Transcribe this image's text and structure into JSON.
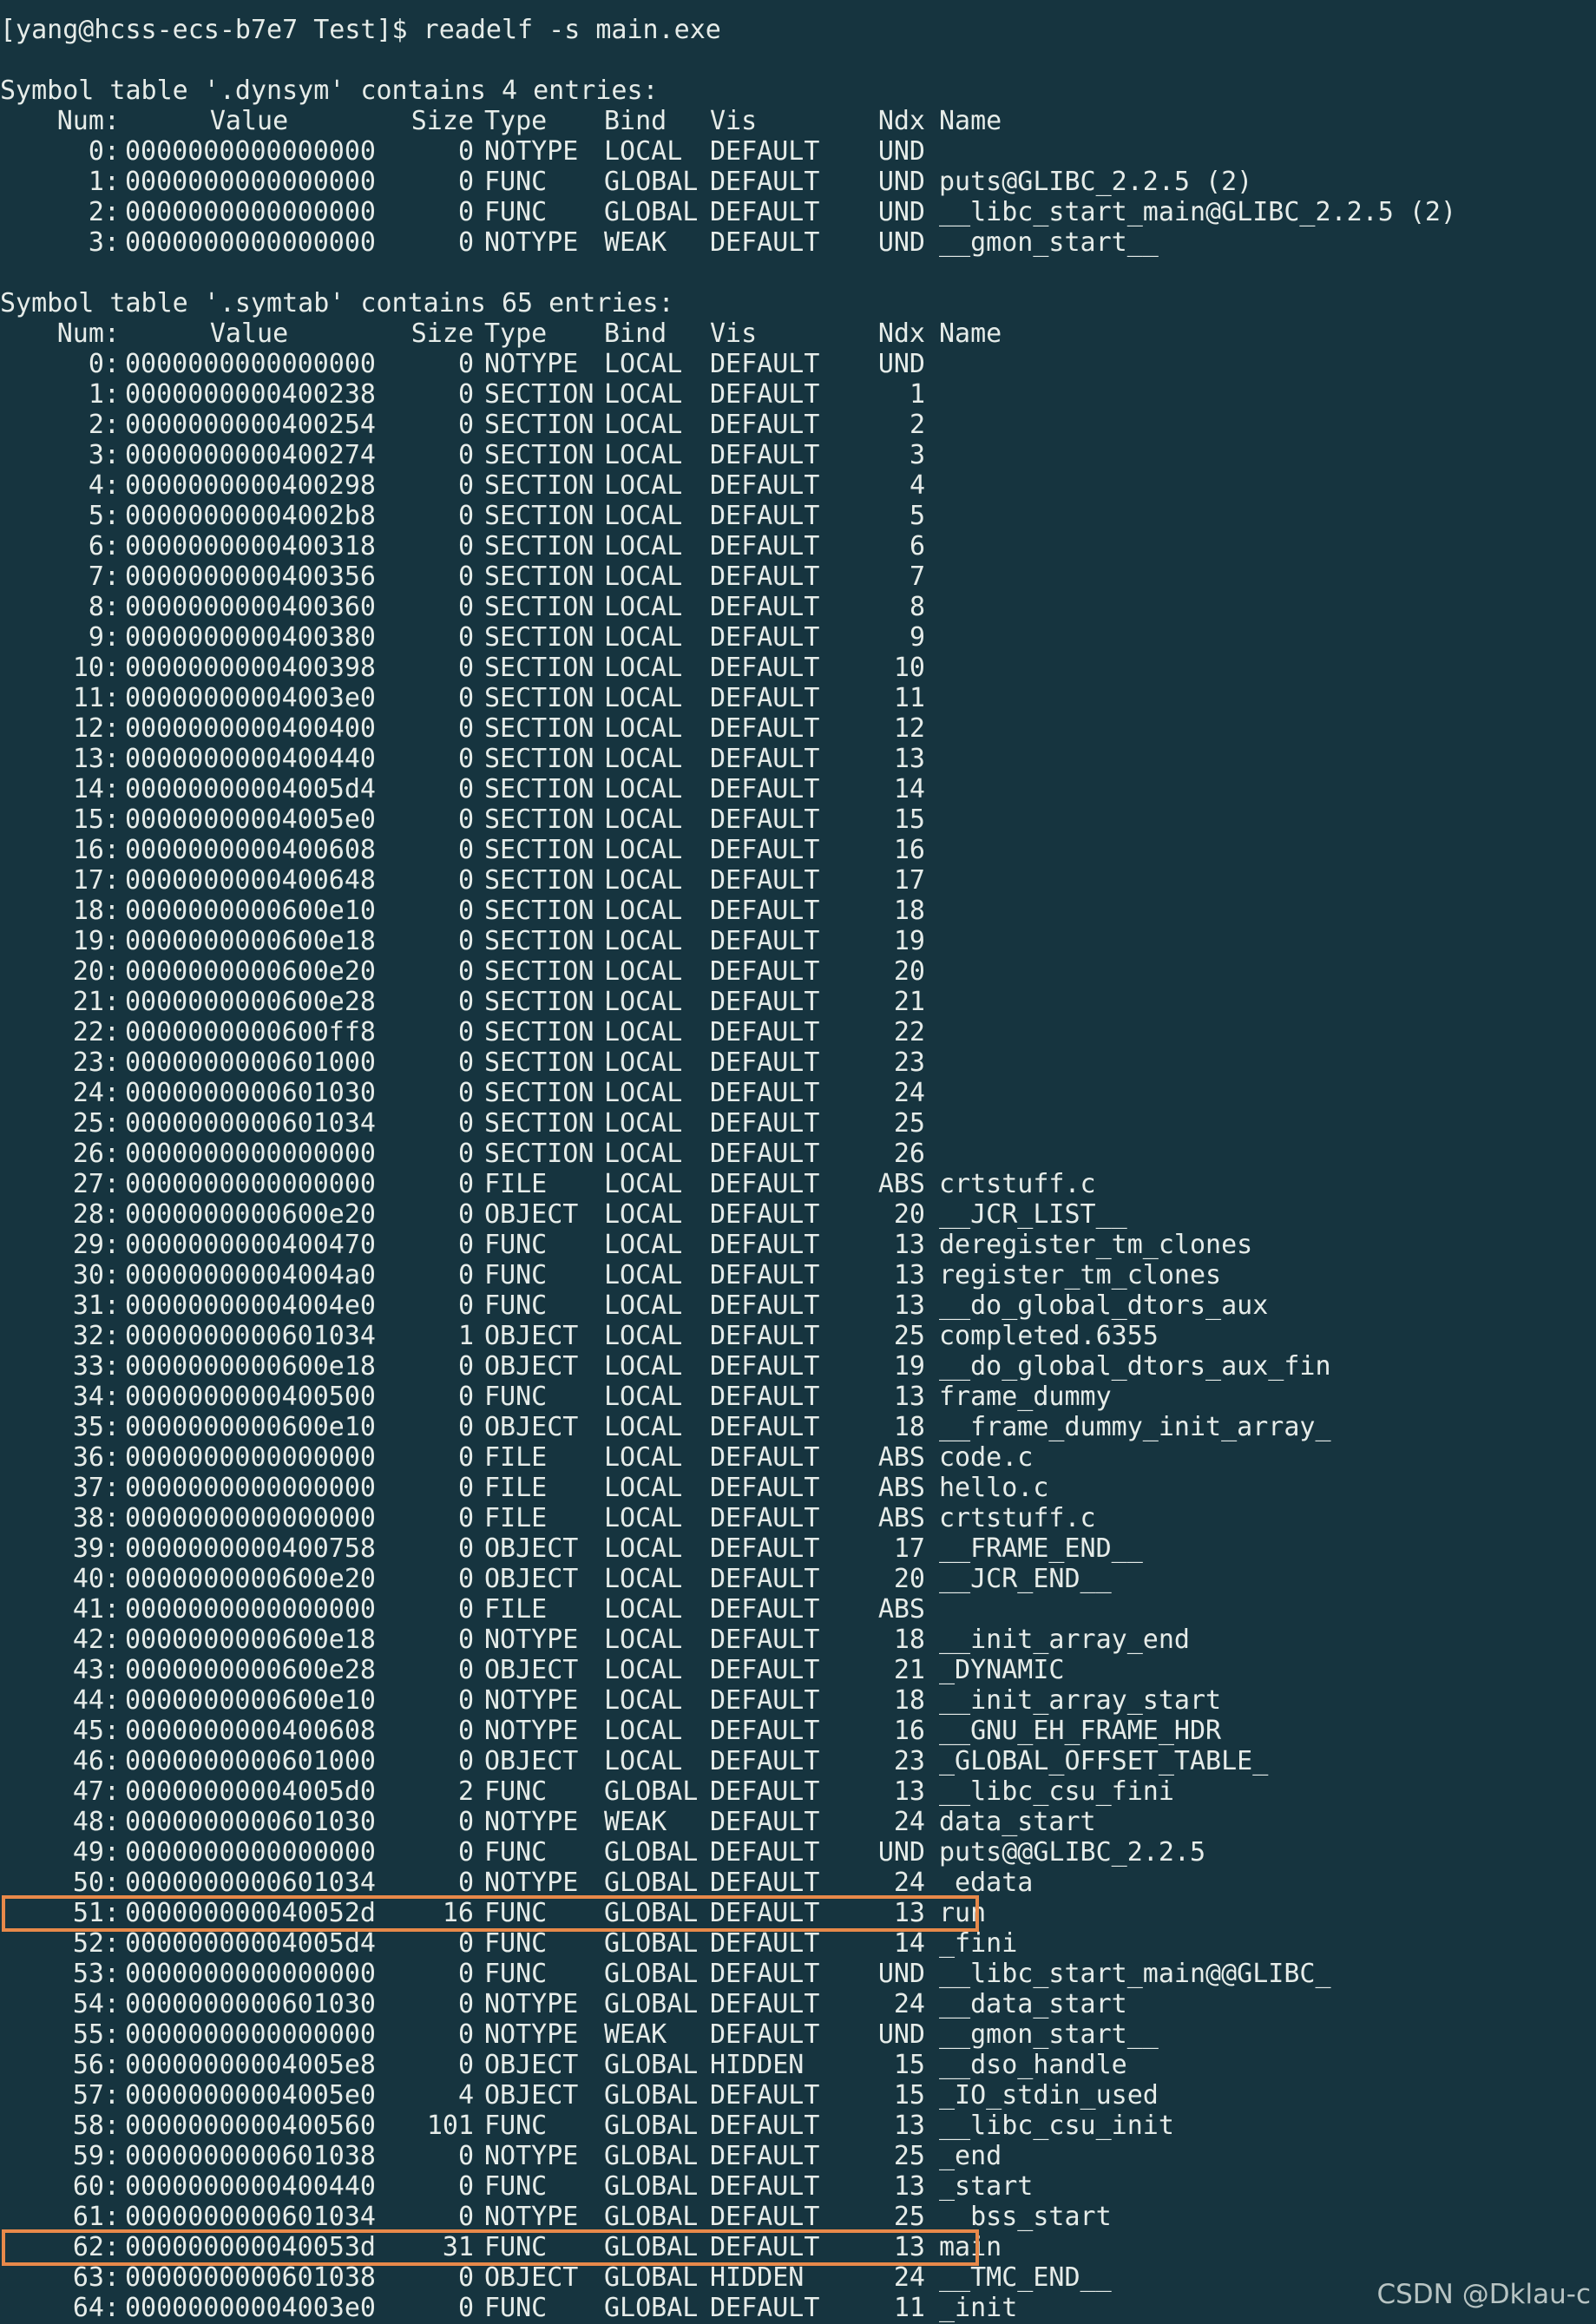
{
  "prompt": "[yang@hcss-ecs-b7e7 Test]$ readelf -s main.exe",
  "headers": {
    "num": "Num:",
    "value": "Value",
    "size": "Size",
    "type": "Type",
    "bind": "Bind",
    "vis": "Vis",
    "ndx": "Ndx",
    "name": "Name"
  },
  "dynsym": {
    "title": "Symbol table '.dynsym' contains 4 entries:",
    "rows": [
      [
        "0:",
        "0000000000000000",
        "0",
        "NOTYPE",
        "LOCAL",
        "DEFAULT",
        "UND",
        ""
      ],
      [
        "1:",
        "0000000000000000",
        "0",
        "FUNC",
        "GLOBAL",
        "DEFAULT",
        "UND",
        "puts@GLIBC_2.2.5 (2)"
      ],
      [
        "2:",
        "0000000000000000",
        "0",
        "FUNC",
        "GLOBAL",
        "DEFAULT",
        "UND",
        "__libc_start_main@GLIBC_2.2.5 (2)"
      ],
      [
        "3:",
        "0000000000000000",
        "0",
        "NOTYPE",
        "WEAK",
        "DEFAULT",
        "UND",
        "__gmon_start__"
      ]
    ]
  },
  "symtab": {
    "title": "Symbol table '.symtab' contains 65 entries:",
    "rows": [
      [
        "0:",
        "0000000000000000",
        "0",
        "NOTYPE",
        "LOCAL",
        "DEFAULT",
        "UND",
        ""
      ],
      [
        "1:",
        "0000000000400238",
        "0",
        "SECTION",
        "LOCAL",
        "DEFAULT",
        "1",
        ""
      ],
      [
        "2:",
        "0000000000400254",
        "0",
        "SECTION",
        "LOCAL",
        "DEFAULT",
        "2",
        ""
      ],
      [
        "3:",
        "0000000000400274",
        "0",
        "SECTION",
        "LOCAL",
        "DEFAULT",
        "3",
        ""
      ],
      [
        "4:",
        "0000000000400298",
        "0",
        "SECTION",
        "LOCAL",
        "DEFAULT",
        "4",
        ""
      ],
      [
        "5:",
        "00000000004002b8",
        "0",
        "SECTION",
        "LOCAL",
        "DEFAULT",
        "5",
        ""
      ],
      [
        "6:",
        "0000000000400318",
        "0",
        "SECTION",
        "LOCAL",
        "DEFAULT",
        "6",
        ""
      ],
      [
        "7:",
        "0000000000400356",
        "0",
        "SECTION",
        "LOCAL",
        "DEFAULT",
        "7",
        ""
      ],
      [
        "8:",
        "0000000000400360",
        "0",
        "SECTION",
        "LOCAL",
        "DEFAULT",
        "8",
        ""
      ],
      [
        "9:",
        "0000000000400380",
        "0",
        "SECTION",
        "LOCAL",
        "DEFAULT",
        "9",
        ""
      ],
      [
        "10:",
        "0000000000400398",
        "0",
        "SECTION",
        "LOCAL",
        "DEFAULT",
        "10",
        ""
      ],
      [
        "11:",
        "00000000004003e0",
        "0",
        "SECTION",
        "LOCAL",
        "DEFAULT",
        "11",
        ""
      ],
      [
        "12:",
        "0000000000400400",
        "0",
        "SECTION",
        "LOCAL",
        "DEFAULT",
        "12",
        ""
      ],
      [
        "13:",
        "0000000000400440",
        "0",
        "SECTION",
        "LOCAL",
        "DEFAULT",
        "13",
        ""
      ],
      [
        "14:",
        "00000000004005d4",
        "0",
        "SECTION",
        "LOCAL",
        "DEFAULT",
        "14",
        ""
      ],
      [
        "15:",
        "00000000004005e0",
        "0",
        "SECTION",
        "LOCAL",
        "DEFAULT",
        "15",
        ""
      ],
      [
        "16:",
        "0000000000400608",
        "0",
        "SECTION",
        "LOCAL",
        "DEFAULT",
        "16",
        ""
      ],
      [
        "17:",
        "0000000000400648",
        "0",
        "SECTION",
        "LOCAL",
        "DEFAULT",
        "17",
        ""
      ],
      [
        "18:",
        "0000000000600e10",
        "0",
        "SECTION",
        "LOCAL",
        "DEFAULT",
        "18",
        ""
      ],
      [
        "19:",
        "0000000000600e18",
        "0",
        "SECTION",
        "LOCAL",
        "DEFAULT",
        "19",
        ""
      ],
      [
        "20:",
        "0000000000600e20",
        "0",
        "SECTION",
        "LOCAL",
        "DEFAULT",
        "20",
        ""
      ],
      [
        "21:",
        "0000000000600e28",
        "0",
        "SECTION",
        "LOCAL",
        "DEFAULT",
        "21",
        ""
      ],
      [
        "22:",
        "0000000000600ff8",
        "0",
        "SECTION",
        "LOCAL",
        "DEFAULT",
        "22",
        ""
      ],
      [
        "23:",
        "0000000000601000",
        "0",
        "SECTION",
        "LOCAL",
        "DEFAULT",
        "23",
        ""
      ],
      [
        "24:",
        "0000000000601030",
        "0",
        "SECTION",
        "LOCAL",
        "DEFAULT",
        "24",
        ""
      ],
      [
        "25:",
        "0000000000601034",
        "0",
        "SECTION",
        "LOCAL",
        "DEFAULT",
        "25",
        ""
      ],
      [
        "26:",
        "0000000000000000",
        "0",
        "SECTION",
        "LOCAL",
        "DEFAULT",
        "26",
        ""
      ],
      [
        "27:",
        "0000000000000000",
        "0",
        "FILE",
        "LOCAL",
        "DEFAULT",
        "ABS",
        "crtstuff.c"
      ],
      [
        "28:",
        "0000000000600e20",
        "0",
        "OBJECT",
        "LOCAL",
        "DEFAULT",
        "20",
        "__JCR_LIST__"
      ],
      [
        "29:",
        "0000000000400470",
        "0",
        "FUNC",
        "LOCAL",
        "DEFAULT",
        "13",
        "deregister_tm_clones"
      ],
      [
        "30:",
        "00000000004004a0",
        "0",
        "FUNC",
        "LOCAL",
        "DEFAULT",
        "13",
        "register_tm_clones"
      ],
      [
        "31:",
        "00000000004004e0",
        "0",
        "FUNC",
        "LOCAL",
        "DEFAULT",
        "13",
        "__do_global_dtors_aux"
      ],
      [
        "32:",
        "0000000000601034",
        "1",
        "OBJECT",
        "LOCAL",
        "DEFAULT",
        "25",
        "completed.6355"
      ],
      [
        "33:",
        "0000000000600e18",
        "0",
        "OBJECT",
        "LOCAL",
        "DEFAULT",
        "19",
        "__do_global_dtors_aux_fin"
      ],
      [
        "34:",
        "0000000000400500",
        "0",
        "FUNC",
        "LOCAL",
        "DEFAULT",
        "13",
        "frame_dummy"
      ],
      [
        "35:",
        "0000000000600e10",
        "0",
        "OBJECT",
        "LOCAL",
        "DEFAULT",
        "18",
        "__frame_dummy_init_array_"
      ],
      [
        "36:",
        "0000000000000000",
        "0",
        "FILE",
        "LOCAL",
        "DEFAULT",
        "ABS",
        "code.c"
      ],
      [
        "37:",
        "0000000000000000",
        "0",
        "FILE",
        "LOCAL",
        "DEFAULT",
        "ABS",
        "hello.c"
      ],
      [
        "38:",
        "0000000000000000",
        "0",
        "FILE",
        "LOCAL",
        "DEFAULT",
        "ABS",
        "crtstuff.c"
      ],
      [
        "39:",
        "0000000000400758",
        "0",
        "OBJECT",
        "LOCAL",
        "DEFAULT",
        "17",
        "__FRAME_END__"
      ],
      [
        "40:",
        "0000000000600e20",
        "0",
        "OBJECT",
        "LOCAL",
        "DEFAULT",
        "20",
        "__JCR_END__"
      ],
      [
        "41:",
        "0000000000000000",
        "0",
        "FILE",
        "LOCAL",
        "DEFAULT",
        "ABS",
        ""
      ],
      [
        "42:",
        "0000000000600e18",
        "0",
        "NOTYPE",
        "LOCAL",
        "DEFAULT",
        "18",
        "__init_array_end"
      ],
      [
        "43:",
        "0000000000600e28",
        "0",
        "OBJECT",
        "LOCAL",
        "DEFAULT",
        "21",
        "_DYNAMIC"
      ],
      [
        "44:",
        "0000000000600e10",
        "0",
        "NOTYPE",
        "LOCAL",
        "DEFAULT",
        "18",
        "__init_array_start"
      ],
      [
        "45:",
        "0000000000400608",
        "0",
        "NOTYPE",
        "LOCAL",
        "DEFAULT",
        "16",
        "__GNU_EH_FRAME_HDR"
      ],
      [
        "46:",
        "0000000000601000",
        "0",
        "OBJECT",
        "LOCAL",
        "DEFAULT",
        "23",
        "_GLOBAL_OFFSET_TABLE_"
      ],
      [
        "47:",
        "00000000004005d0",
        "2",
        "FUNC",
        "GLOBAL",
        "DEFAULT",
        "13",
        "__libc_csu_fini"
      ],
      [
        "48:",
        "0000000000601030",
        "0",
        "NOTYPE",
        "WEAK",
        "DEFAULT",
        "24",
        "data_start"
      ],
      [
        "49:",
        "0000000000000000",
        "0",
        "FUNC",
        "GLOBAL",
        "DEFAULT",
        "UND",
        "puts@@GLIBC_2.2.5"
      ],
      [
        "50:",
        "0000000000601034",
        "0",
        "NOTYPE",
        "GLOBAL",
        "DEFAULT",
        "24",
        "_edata"
      ],
      [
        "51:",
        "000000000040052d",
        "16",
        "FUNC",
        "GLOBAL",
        "DEFAULT",
        "13",
        "run"
      ],
      [
        "52:",
        "00000000004005d4",
        "0",
        "FUNC",
        "GLOBAL",
        "DEFAULT",
        "14",
        "_fini"
      ],
      [
        "53:",
        "0000000000000000",
        "0",
        "FUNC",
        "GLOBAL",
        "DEFAULT",
        "UND",
        "__libc_start_main@@GLIBC_"
      ],
      [
        "54:",
        "0000000000601030",
        "0",
        "NOTYPE",
        "GLOBAL",
        "DEFAULT",
        "24",
        "__data_start"
      ],
      [
        "55:",
        "0000000000000000",
        "0",
        "NOTYPE",
        "WEAK",
        "DEFAULT",
        "UND",
        "__gmon_start__"
      ],
      [
        "56:",
        "00000000004005e8",
        "0",
        "OBJECT",
        "GLOBAL",
        "HIDDEN",
        "15",
        "__dso_handle"
      ],
      [
        "57:",
        "00000000004005e0",
        "4",
        "OBJECT",
        "GLOBAL",
        "DEFAULT",
        "15",
        "_IO_stdin_used"
      ],
      [
        "58:",
        "0000000000400560",
        "101",
        "FUNC",
        "GLOBAL",
        "DEFAULT",
        "13",
        "__libc_csu_init"
      ],
      [
        "59:",
        "0000000000601038",
        "0",
        "NOTYPE",
        "GLOBAL",
        "DEFAULT",
        "25",
        "_end"
      ],
      [
        "60:",
        "0000000000400440",
        "0",
        "FUNC",
        "GLOBAL",
        "DEFAULT",
        "13",
        "_start"
      ],
      [
        "61:",
        "0000000000601034",
        "0",
        "NOTYPE",
        "GLOBAL",
        "DEFAULT",
        "25",
        "__bss_start"
      ],
      [
        "62:",
        "000000000040053d",
        "31",
        "FUNC",
        "GLOBAL",
        "DEFAULT",
        "13",
        "main"
      ],
      [
        "63:",
        "0000000000601038",
        "0",
        "OBJECT",
        "GLOBAL",
        "HIDDEN",
        "24",
        "__TMC_END__"
      ],
      [
        "64:",
        "00000000004003e0",
        "0",
        "FUNC",
        "GLOBAL",
        "DEFAULT",
        "11",
        "_init"
      ]
    ]
  },
  "highlighted_symbols": [
    "run",
    "main"
  ],
  "colors": {
    "background": "#16343f",
    "text": "#e6ece9",
    "highlight": "#e8894a"
  },
  "watermark": "CSDN @Dklau-c"
}
